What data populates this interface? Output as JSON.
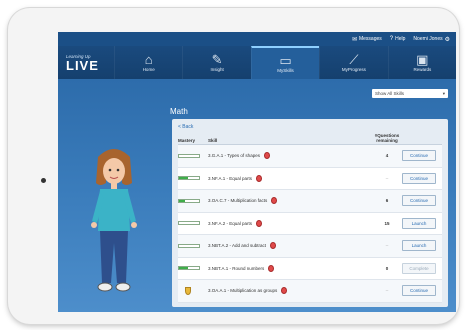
{
  "topbar": {
    "messages_label": "Messages",
    "help_label": "Help",
    "user_label": "Noemi Jones"
  },
  "logo": {
    "small": "Learning Up",
    "big": "LIVE"
  },
  "nav": [
    {
      "label": "Home",
      "icon": "home-icon",
      "glyph": "⌂"
    },
    {
      "label": "Insight",
      "icon": "clipboard-icon",
      "glyph": "✎"
    },
    {
      "label": "MySkills",
      "icon": "book-icon",
      "glyph": "▭"
    },
    {
      "label": "MyProgress",
      "icon": "chart-icon",
      "glyph": "⟋"
    },
    {
      "label": "Rewards",
      "icon": "treasure-chest-icon",
      "glyph": "▣"
    }
  ],
  "select": {
    "value": "Show All Skills",
    "arrow": "▾"
  },
  "subject": "Math",
  "panel": {
    "back_label": "< Back",
    "headers": {
      "mastery": "Mastery",
      "skill": "Skill",
      "questions": "#Questions remaining"
    },
    "rows": [
      {
        "mastery": 0.0,
        "medal": false,
        "skill": "3.G.A.1 - Types of shapes",
        "remaining": "4",
        "action": "Continue",
        "faint": false
      },
      {
        "mastery": 0.45,
        "medal": false,
        "skill": "3.NF.A.1 - Equal parts",
        "remaining": "–",
        "action": "Continue",
        "faint": false
      },
      {
        "mastery": 0.3,
        "medal": false,
        "skill": "3.OA.C.7 - Multiplication facts",
        "remaining": "6",
        "action": "Continue",
        "faint": false
      },
      {
        "mastery": 0.0,
        "medal": false,
        "skill": "3.NF.A.2 - Equal parts",
        "remaining": "15",
        "action": "Launch",
        "faint": false
      },
      {
        "mastery": 0.0,
        "medal": false,
        "skill": "3.NBT.A.2 - Add and subtract",
        "remaining": "–",
        "action": "Launch",
        "faint": false
      },
      {
        "mastery": 0.45,
        "medal": false,
        "skill": "3.NBT.A.1 - Round numbers",
        "remaining": "0",
        "action": "Complete",
        "faint": true
      },
      {
        "mastery": 1.0,
        "medal": true,
        "skill": "3.OA.A.1 - Multiplication as groups",
        "remaining": "–",
        "action": "Continue",
        "faint": false
      }
    ]
  },
  "colors": {
    "brand_blue": "#1f5c9a",
    "progress_green": "#3fae49",
    "button_text": "#2a6db3"
  }
}
